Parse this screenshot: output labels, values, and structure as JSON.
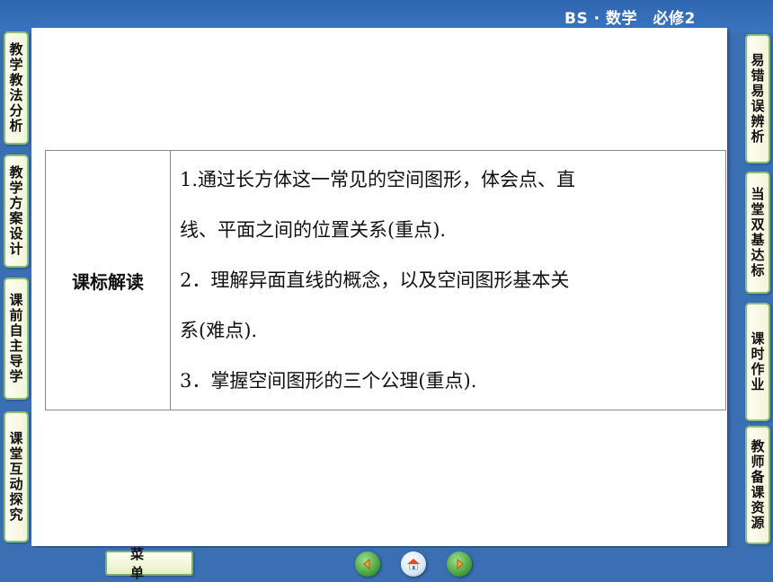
{
  "header": {
    "title": "BS · 数学　必修2"
  },
  "sidebar_left": [
    {
      "label": "教学教法分析"
    },
    {
      "label": "教学方案设计"
    },
    {
      "label": "课前自主导学"
    },
    {
      "label": "课堂互动探究"
    }
  ],
  "sidebar_right": [
    {
      "label": "易错易误辨析"
    },
    {
      "label": "当堂双基达标"
    },
    {
      "label": "课时作业"
    },
    {
      "label": "教师备课资源"
    }
  ],
  "table": {
    "label": "课标解读",
    "lines": [
      "1.通过长方体这一常见的空间图形，体会点、直",
      "线、平面之间的位置关系(重点).",
      "2．理解异面直线的概念，以及空间图形基本关",
      "系(难点).",
      "3．掌握空间图形的三个公理(重点)."
    ]
  },
  "footer": {
    "menu_label": "菜 单",
    "nav_icons": [
      "back-arrow-icon",
      "home-icon",
      "forward-arrow-icon"
    ]
  }
}
